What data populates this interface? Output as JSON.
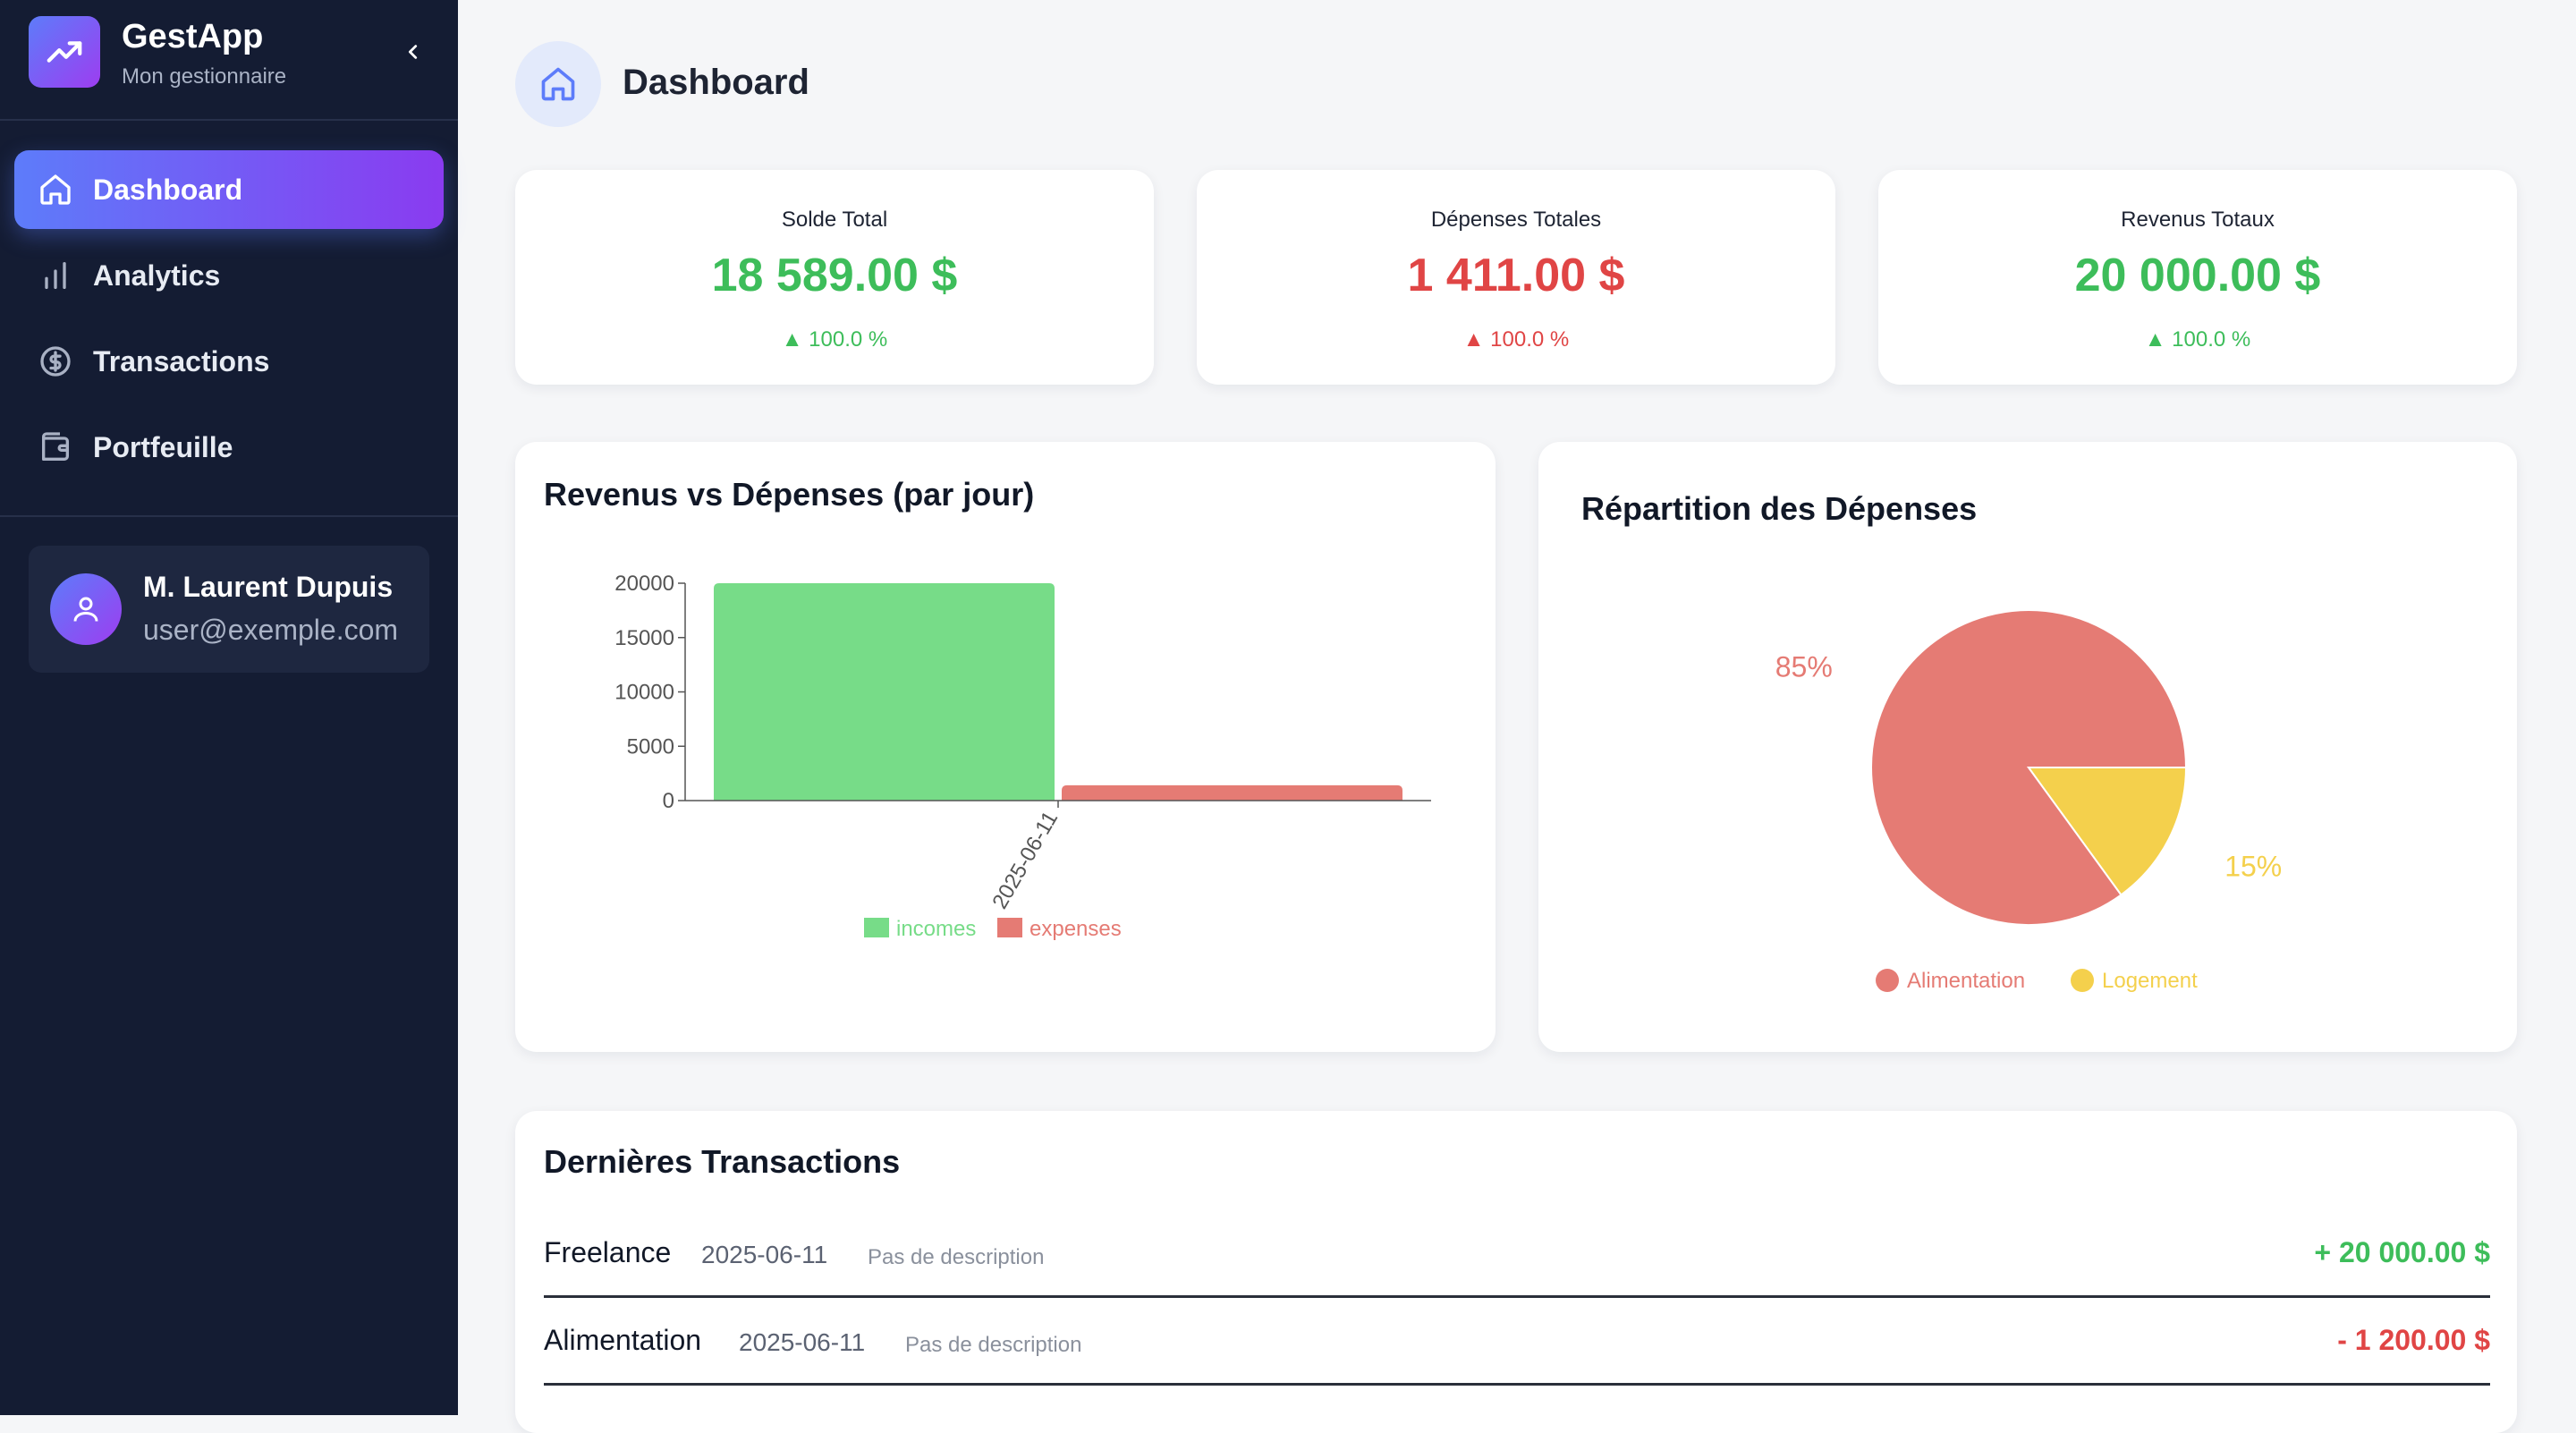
{
  "app": {
    "title": "GestApp",
    "subtitle": "Mon gestionnaire",
    "logo_icon": "trending-up-icon"
  },
  "sidebar": {
    "items": [
      {
        "label": "Dashboard",
        "icon": "home-icon",
        "active": true
      },
      {
        "label": "Analytics",
        "icon": "bar-chart-icon",
        "active": false
      },
      {
        "label": "Transactions",
        "icon": "dollar-circle-icon",
        "active": false
      },
      {
        "label": "Portfeuille",
        "icon": "wallet-icon",
        "active": false
      }
    ],
    "user": {
      "name": "M. Laurent Dupuis",
      "email": "user@exemple.com"
    }
  },
  "header": {
    "title": "Dashboard"
  },
  "stats": [
    {
      "label": "Solde Total",
      "value": "18 589.00 $",
      "change": "▲ 100.0 %",
      "color": "#3dbd5a"
    },
    {
      "label": "Dépenses Totales",
      "value": "1 411.00 $",
      "change": "▲ 100.0 %",
      "color": "#e04545"
    },
    {
      "label": "Revenus Totaux",
      "value": "20 000.00 $",
      "change": "▲ 100.0 %",
      "color": "#3dbd5a"
    }
  ],
  "bar_card": {
    "title": "Revenus vs Dépenses (par jour)"
  },
  "pie_card": {
    "title": "Répartition des Dépenses"
  },
  "chart_data": [
    {
      "type": "bar",
      "title": "Revenus vs Dépenses (par jour)",
      "categories": [
        "2025-06-11"
      ],
      "series": [
        {
          "name": "incomes",
          "values": [
            20000
          ],
          "color": "#77dc88"
        },
        {
          "name": "expenses",
          "values": [
            1411
          ],
          "color": "#e57b74"
        }
      ],
      "ylim": [
        0,
        20000
      ],
      "yticks": [
        0,
        5000,
        10000,
        15000,
        20000
      ],
      "legend": "bottom"
    },
    {
      "type": "pie",
      "title": "Répartition des Dépenses",
      "slices": [
        {
          "name": "Alimentation",
          "value": 85,
          "label": "85%",
          "color": "#e57b74"
        },
        {
          "name": "Logement",
          "value": 15,
          "label": "15%",
          "color": "#f4d04c"
        }
      ],
      "legend": "bottom"
    }
  ],
  "transactions": {
    "title": "Dernières Transactions",
    "rows": [
      {
        "name": "Freelance",
        "date": "2025-06-11",
        "description": "Pas de description",
        "amount": "+ 20 000.00 $",
        "type": "income"
      },
      {
        "name": "Alimentation",
        "date": "2025-06-11",
        "description": "Pas de description",
        "amount": "- 1 200.00 $",
        "type": "expense"
      }
    ]
  }
}
